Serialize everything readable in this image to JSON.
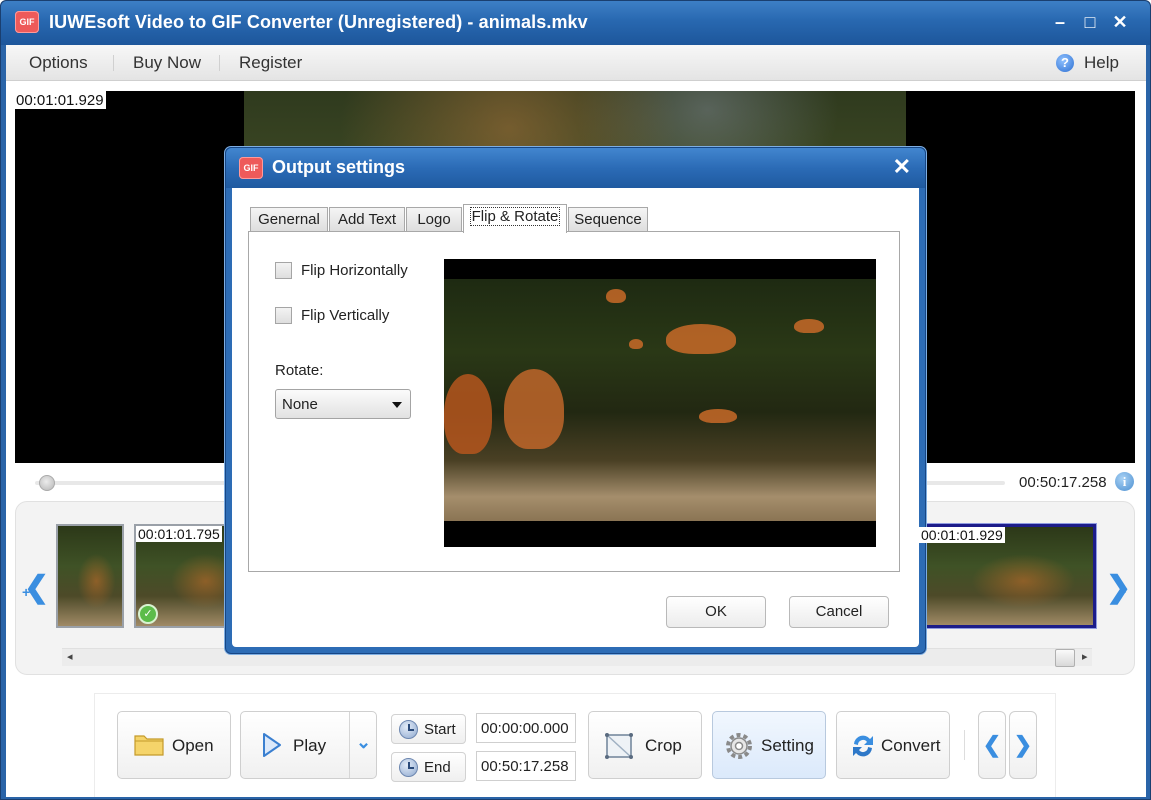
{
  "window": {
    "title": "IUWEsoft Video to GIF Converter (Unregistered) - animals.mkv",
    "app_icon": "app-logo-icon",
    "controls": {
      "minimize": "–",
      "maximize": "□",
      "close": "✕"
    }
  },
  "menu": {
    "items": [
      {
        "label": "Options"
      },
      {
        "label": "Buy Now"
      },
      {
        "label": "Register"
      }
    ],
    "help": {
      "icon": "?",
      "label": "Help"
    }
  },
  "player": {
    "current_time": "00:01:01.929",
    "duration": "00:50:17.258",
    "info_icon": "i",
    "seek_progress": 0.01
  },
  "filmstrip": {
    "prev_arrow": "❮",
    "next_arrow": "❯",
    "plus": "+",
    "thumbnails": [
      {
        "time": "",
        "badge": ""
      },
      {
        "time": "00:01:01.795",
        "badge": "✓"
      },
      {
        "time": "00:01:01.929",
        "badge": "",
        "selected": true
      }
    ],
    "scroll_left": "◂",
    "scroll_right": "▸"
  },
  "toolbar": {
    "open_label": "Open",
    "play_label": "Play",
    "play_dropdown": "⌄",
    "start_label": "Start",
    "end_label": "End",
    "start_time": "00:00:00.000",
    "end_time": "00:50:17.258",
    "crop_label": "Crop",
    "setting_label": "Setting",
    "convert_label": "Convert",
    "prev_label": "❮",
    "next_label": "❯"
  },
  "dialog": {
    "title": "Output settings",
    "close": "✕",
    "tabs": [
      {
        "label": "Genernal",
        "active": false
      },
      {
        "label": "Add Text",
        "active": false
      },
      {
        "label": "Logo",
        "active": false
      },
      {
        "label": "Flip & Rotate",
        "active": true
      },
      {
        "label": "Sequence",
        "active": false
      }
    ],
    "flip_horizontally": {
      "label": "Flip Horizontally",
      "checked": false
    },
    "flip_vertically": {
      "label": "Flip Vertically",
      "checked": false
    },
    "rotate_label": "Rotate:",
    "rotate_value": "None",
    "ok_label": "OK",
    "cancel_label": "Cancel"
  },
  "colors": {
    "titlebar": "#2868b0",
    "accent": "#3a8ee0",
    "app_icon": "#ee5a5a",
    "selected_thumb": "#1c1c8a"
  }
}
